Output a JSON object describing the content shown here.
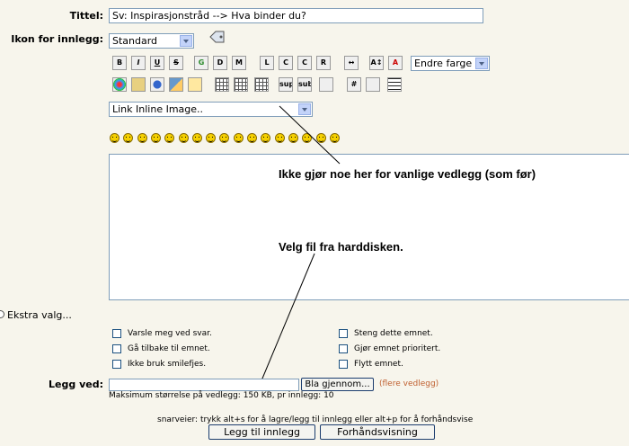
{
  "form": {
    "title_label": "Tittel:",
    "title_value": "Sv: Inspirasjonstråd --> Hva binder du?",
    "icon_label": "Ikon for innlegg:",
    "icon_value": "Standard",
    "color_select": "Endre farge",
    "image_select": "Link Inline Image..",
    "extra_options": "Ekstra valg...",
    "attach_label": "Legg ved:",
    "browse_button": "Bla gjennom...",
    "more_attachments": "(flere vedlegg)",
    "max_size": "Maksimum størrelse på vedlegg: 150 KB, pr innlegg: 10",
    "shortcuts": "snarveier: trykk alt+s for å lagre/legg til innlegg eller alt+p for å forhåndsvise",
    "submit_button": "Legg til innlegg",
    "preview_button": "Forhåndsvisning"
  },
  "toolbar": {
    "row1": [
      "B",
      "I",
      "U",
      "S",
      "G",
      "D",
      "M",
      "L",
      "C",
      "C",
      "R",
      "↔",
      "A↕",
      "A"
    ],
    "row1_icons": [
      "bold-icon",
      "italic-icon",
      "underline-icon",
      "strike-icon",
      "glow-icon",
      "shadow-icon",
      "move-icon",
      "align-left-icon",
      "align-justify-icon",
      "align-center-icon",
      "align-right-icon",
      "horizontal-rule-icon",
      "font-size-icon",
      "font-color-icon"
    ],
    "row2": [
      "",
      "",
      "",
      "",
      "",
      "",
      "",
      "sup",
      "sub",
      "",
      "#",
      "",
      ""
    ],
    "row2_icons": [
      "flash-icon",
      "image-icon",
      "link-icon",
      "email-icon",
      "ftp-icon",
      "table-icon",
      "table-row-icon",
      "superscript-icon",
      "subscript-icon",
      "teletype-icon",
      "code-icon",
      "quote-icon",
      "list-icon"
    ]
  },
  "options": {
    "left": [
      "Varsle meg ved svar.",
      "Gå tilbake til emnet.",
      "Ikke bruk smilefjes."
    ],
    "right": [
      "Steng dette emnet.",
      "Gjør emnet prioritert.",
      "Flytt emnet."
    ]
  },
  "annotations": {
    "note1": "Ikke gjør noe her for vanlige vedlegg (som før)",
    "note2": "Velg fil fra harddisken."
  },
  "colors": {
    "accent": "#c06030",
    "border": "#7f9db9",
    "background": "#f7f5ec"
  }
}
